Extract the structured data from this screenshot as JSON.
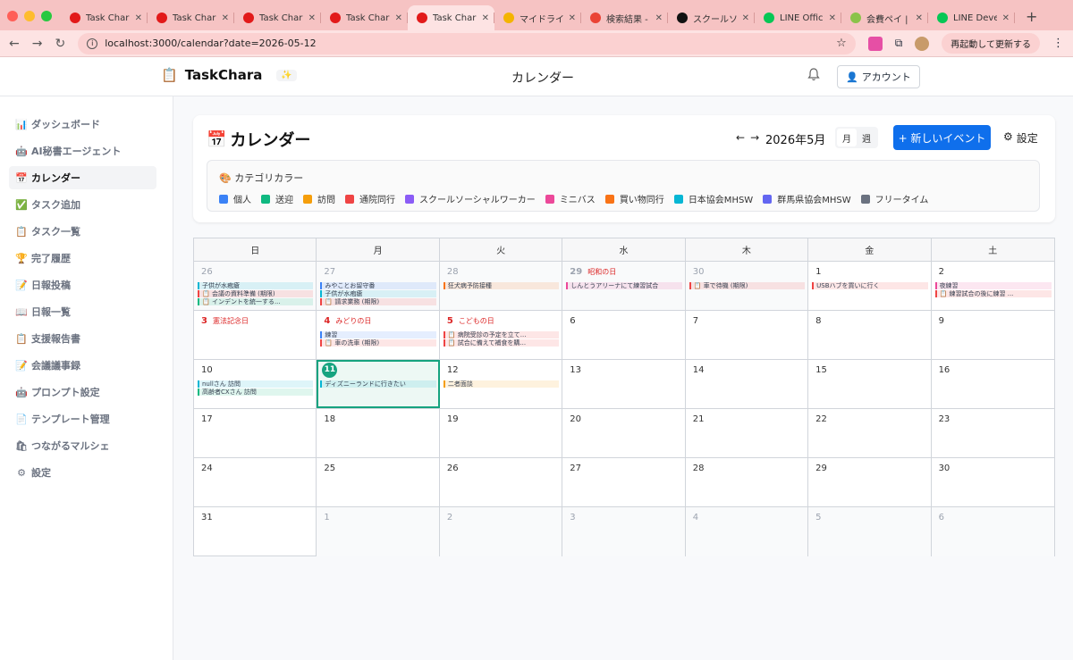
{
  "browser": {
    "tabs": [
      {
        "title": "Task Charac",
        "fav": "#e21a1a",
        "active": false
      },
      {
        "title": "Task Charac",
        "fav": "#e21a1a",
        "active": false
      },
      {
        "title": "Task Charac",
        "fav": "#e21a1a",
        "active": false
      },
      {
        "title": "Task Charac",
        "fav": "#e21a1a",
        "active": false
      },
      {
        "title": "Task Charac",
        "fav": "#e21a1a",
        "active": true
      },
      {
        "title": "マイドライブ",
        "fav": "#f4b400",
        "active": false
      },
      {
        "title": "検索結果 - to",
        "fav": "#ea4335",
        "active": false
      },
      {
        "title": "スクールソー",
        "fav": "#111111",
        "active": false
      },
      {
        "title": "LINE Officia",
        "fav": "#06c755",
        "active": false
      },
      {
        "title": "会費ペイ | 会",
        "fav": "#8bc34a",
        "active": false
      },
      {
        "title": "LINE Develo",
        "fav": "#06c755",
        "active": false
      }
    ],
    "new_tab": "+",
    "url": "localhost:3000/calendar?date=2026-05-12",
    "restart_label": "再起動して更新する"
  },
  "header": {
    "brand_icon": "📋",
    "brand": "TaskChara",
    "sparkle": "✨",
    "page_title": "カレンダー",
    "account_icon": "👤",
    "account_label": "アカウント"
  },
  "sidebar": {
    "items": [
      {
        "icon": "📊",
        "label": "ダッシュボード",
        "active": false
      },
      {
        "icon": "🤖",
        "label": "AI秘書エージェント",
        "active": false
      },
      {
        "icon": "📅",
        "label": "カレンダー",
        "active": true
      },
      {
        "icon": "✅",
        "label": "タスク追加",
        "active": false
      },
      {
        "icon": "📋",
        "label": "タスク一覧",
        "active": false
      },
      {
        "icon": "🏆",
        "label": "完了履歴",
        "active": false
      },
      {
        "icon": "📝",
        "label": "日報投稿",
        "active": false
      },
      {
        "icon": "📖",
        "label": "日報一覧",
        "active": false
      },
      {
        "icon": "📋",
        "label": "支援報告書",
        "active": false
      },
      {
        "icon": "📝",
        "label": "会議議事録",
        "active": false
      },
      {
        "icon": "🤖",
        "label": "プロンプト設定",
        "active": false
      },
      {
        "icon": "📄",
        "label": "テンプレート管理",
        "active": false
      },
      {
        "icon": "🛍",
        "label": "つながるマルシェ",
        "active": false
      },
      {
        "icon": "⚙",
        "label": "設定",
        "active": false
      }
    ]
  },
  "calendar": {
    "title_icon": "📅",
    "title": "カレンダー",
    "prev": "←",
    "next": "→",
    "month_label": "2026年5月",
    "view_month": "月",
    "view_week": "週",
    "new_event": "+ 新しいイベント",
    "settings_icon": "⚙",
    "settings_label": "設定",
    "category_header": "🎨 カテゴリカラー",
    "categories": [
      {
        "name": "個人",
        "color": "#3b82f6"
      },
      {
        "name": "送迎",
        "color": "#10b981"
      },
      {
        "name": "訪問",
        "color": "#f59e0b"
      },
      {
        "name": "通院同行",
        "color": "#ef4444"
      },
      {
        "name": "スクールソーシャルワーカー",
        "color": "#8b5cf6"
      },
      {
        "name": "ミニバス",
        "color": "#ec4899"
      },
      {
        "name": "買い物同行",
        "color": "#f97316"
      },
      {
        "name": "日本協会MHSW",
        "color": "#06b6d4"
      },
      {
        "name": "群馬県協会MHSW",
        "color": "#6366f1"
      },
      {
        "name": "フリータイム",
        "color": "#6b7280"
      }
    ],
    "weekdays": [
      "日",
      "月",
      "火",
      "水",
      "木",
      "金",
      "土"
    ],
    "weeks": [
      [
        {
          "day": "26",
          "other": true,
          "events": [
            {
              "text": "子供が水疱瘡",
              "color": "#06b6d4"
            },
            {
              "text": "📋 会議の資料準備 (期限)",
              "color": "#ef4444"
            },
            {
              "text": "📋 インデントを統一する...",
              "color": "#10b981"
            }
          ]
        },
        {
          "day": "27",
          "other": true,
          "events": [
            {
              "text": "みやことお留守番",
              "color": "#3b82f6"
            },
            {
              "text": "子供が水疱瘡",
              "color": "#06b6d4"
            },
            {
              "text": "📋 請求業務 (期限)",
              "color": "#ef4444"
            }
          ]
        },
        {
          "day": "28",
          "other": true,
          "events": [
            {
              "text": "狂犬病予防接種",
              "color": "#f97316"
            }
          ]
        },
        {
          "day": "29",
          "other": true,
          "holiday": "昭和の日",
          "events": [
            {
              "text": "しんとうアリーナにて練習試合",
              "color": "#ec4899"
            }
          ]
        },
        {
          "day": "30",
          "other": true,
          "events": [
            {
              "text": "📋 車で待機 (期限)",
              "color": "#ef4444"
            }
          ]
        },
        {
          "day": "1",
          "events": [
            {
              "text": "USBハブを買いに行く",
              "color": "#ef4444"
            }
          ]
        },
        {
          "day": "2",
          "events": [
            {
              "text": "夜練習",
              "color": "#ec4899"
            },
            {
              "text": "📋 練習試合の後に練習 ...",
              "color": "#ef4444"
            }
          ]
        }
      ],
      [
        {
          "day": "3",
          "holiday": "憲法記念日",
          "events": []
        },
        {
          "day": "4",
          "holiday": "みどりの日",
          "events": [
            {
              "text": "練習",
              "color": "#3b82f6"
            },
            {
              "text": "📋 車の洗車 (期限)",
              "color": "#ef4444"
            }
          ]
        },
        {
          "day": "5",
          "holiday": "こどもの日",
          "events": [
            {
              "text": "📋 病院受診の予定を立て...",
              "color": "#ef4444"
            },
            {
              "text": "📋 試合に備えて補食を購...",
              "color": "#ef4444"
            }
          ]
        },
        {
          "day": "6",
          "events": []
        },
        {
          "day": "7",
          "events": []
        },
        {
          "day": "8",
          "events": []
        },
        {
          "day": "9",
          "events": []
        }
      ],
      [
        {
          "day": "10",
          "events": [
            {
              "text": "nullさん 訪問",
              "color": "#06b6d4"
            },
            {
              "text": "高齢者CXさん 訪問",
              "color": "#10b981"
            }
          ]
        },
        {
          "day": "11",
          "today": true,
          "events": [
            {
              "text": "ディズニーランドに行きたい",
              "color": "#06b6d4"
            }
          ]
        },
        {
          "day": "12",
          "events": [
            {
              "text": "二者面談",
              "color": "#f59e0b"
            }
          ]
        },
        {
          "day": "13",
          "events": []
        },
        {
          "day": "14",
          "events": []
        },
        {
          "day": "15",
          "events": []
        },
        {
          "day": "16",
          "events": []
        }
      ],
      [
        {
          "day": "17",
          "events": []
        },
        {
          "day": "18",
          "events": []
        },
        {
          "day": "19",
          "events": []
        },
        {
          "day": "20",
          "events": []
        },
        {
          "day": "21",
          "events": []
        },
        {
          "day": "22",
          "events": []
        },
        {
          "day": "23",
          "events": []
        }
      ],
      [
        {
          "day": "24",
          "events": []
        },
        {
          "day": "25",
          "events": []
        },
        {
          "day": "26",
          "events": []
        },
        {
          "day": "27",
          "events": []
        },
        {
          "day": "28",
          "events": []
        },
        {
          "day": "29",
          "events": []
        },
        {
          "day": "30",
          "events": []
        }
      ],
      [
        {
          "day": "31",
          "events": []
        },
        {
          "day": "1",
          "other": true,
          "events": []
        },
        {
          "day": "2",
          "other": true,
          "events": []
        },
        {
          "day": "3",
          "other": true,
          "events": []
        },
        {
          "day": "4",
          "other": true,
          "events": []
        },
        {
          "day": "5",
          "other": true,
          "events": []
        },
        {
          "day": "6",
          "other": true,
          "events": []
        }
      ]
    ]
  }
}
